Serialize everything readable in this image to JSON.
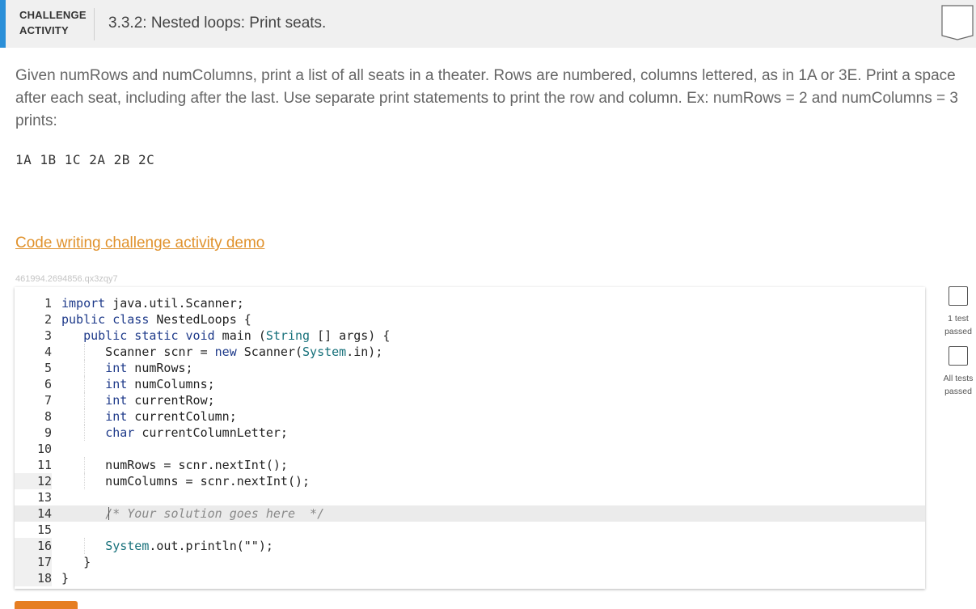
{
  "header": {
    "label_line1": "CHALLENGE",
    "label_line2": "ACTIVITY",
    "title": "3.3.2: Nested loops: Print seats."
  },
  "description": "Given numRows and numColumns, print a list of all seats in a theater. Rows are numbered, columns lettered, as in 1A or 3E. Print a space after each seat, including after the last. Use separate print statements to print the row and column. Ex: numRows = 2 and numColumns = 3 prints:",
  "example_output": "1A 1B 1C 2A 2B 2C",
  "demo_link": "Code writing challenge activity demo",
  "activity_id": "461994.2694856.qx3zqy7",
  "editor": {
    "line_numbers": [
      "1",
      "2",
      "3",
      "4",
      "5",
      "6",
      "7",
      "8",
      "9",
      "10",
      "11",
      "12",
      "13",
      "14",
      "15",
      "16",
      "17",
      "18"
    ]
  },
  "side": {
    "check1_label_a": "1 test",
    "check1_label_b": "passed",
    "check2_label_a": "All tests",
    "check2_label_b": "passed"
  },
  "colors": {
    "accent": "#2b8fd8",
    "link": "#e0922d",
    "keyword": "#1e3a8a",
    "type": "#16707a"
  }
}
